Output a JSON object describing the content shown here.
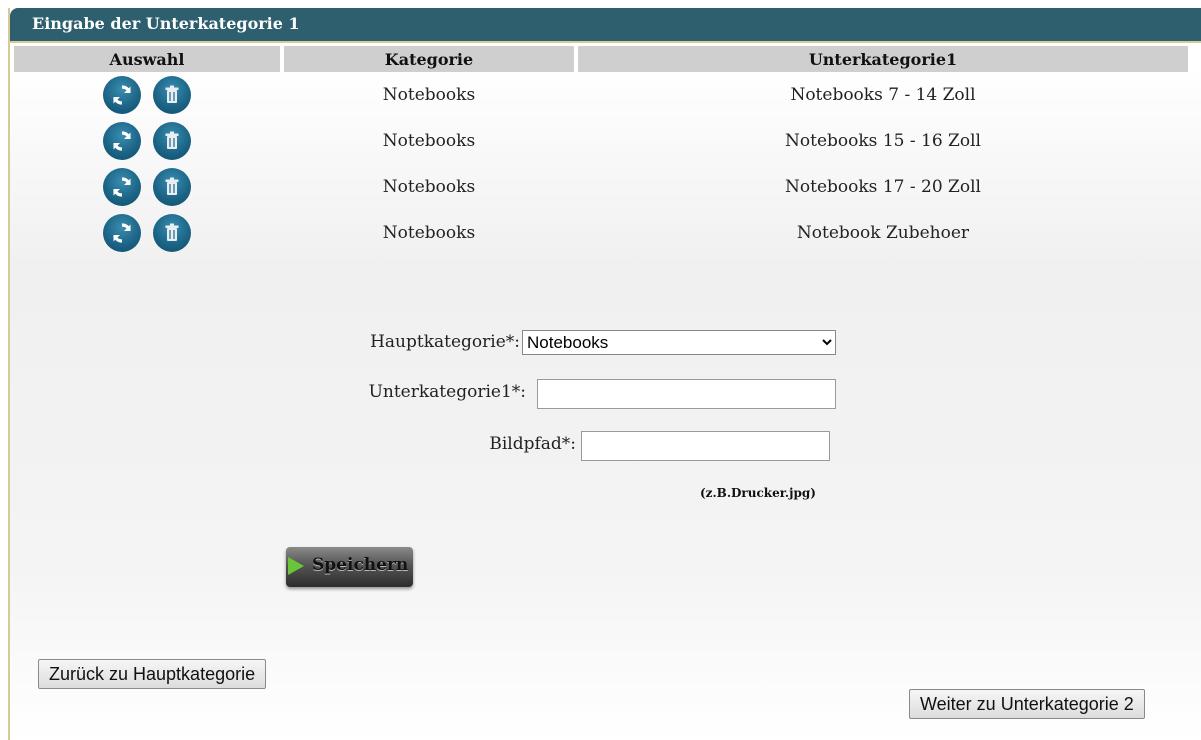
{
  "window": {
    "title": "Eingabe der Unterkategorie 1"
  },
  "table": {
    "headers": [
      "Auswahl",
      "Kategorie",
      "Unterkategorie1"
    ],
    "rows": [
      {
        "kategorie": "Notebooks",
        "unterkategorie": "Notebooks 7 - 14 Zoll"
      },
      {
        "kategorie": "Notebooks",
        "unterkategorie": "Notebooks 15 - 16 Zoll"
      },
      {
        "kategorie": "Notebooks",
        "unterkategorie": "Notebooks 17 - 20 Zoll"
      },
      {
        "kategorie": "Notebooks",
        "unterkategorie": "Notebook Zubehoer"
      }
    ],
    "row_icons": [
      "refresh-icon",
      "trash-icon"
    ]
  },
  "form": {
    "hauptkategorie_label": "Hauptkategorie*:",
    "hauptkategorie_value": "Notebooks",
    "unterkategorie_label": "Unterkategorie1*:",
    "unterkategorie_value": "",
    "bildpfad_label": "Bildpfad*:",
    "bildpfad_value": "",
    "hint": "(z.B.Drucker.jpg)",
    "save_label": "Speichern"
  },
  "nav": {
    "back_label": "Zurück zu Hauptkategorie",
    "next_label": "Weiter zu Unterkategorie 2"
  },
  "colors": {
    "titlebar": "#2e5f6f",
    "icon": "#1c6587",
    "header_bg": "#cfcfcf"
  }
}
